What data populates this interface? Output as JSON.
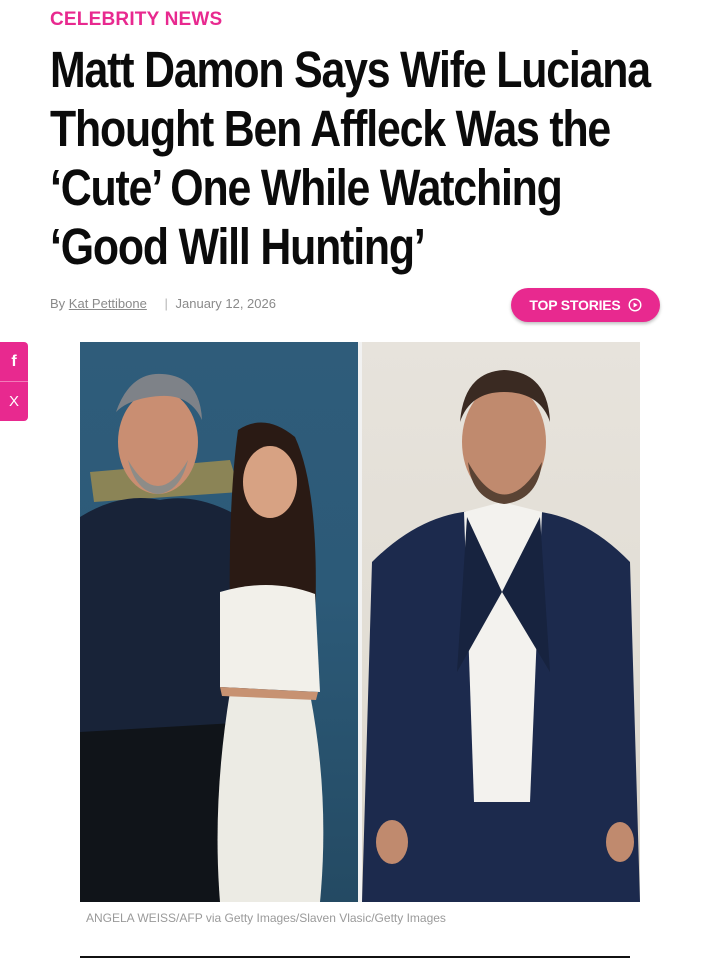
{
  "article": {
    "category": "CELEBRITY NEWS",
    "headline": "Matt Damon Says Wife Luciana Thought Ben Affleck Was the ‘Cute’ One While Watching ‘Good Will Hunting’",
    "byline_prefix": "By",
    "author": "Kat Pettibone",
    "date_separator": "|",
    "date": "January 12, 2026",
    "top_stories_label": "TOP STORIES",
    "photo_credit": "ANGELA WEISS/AFP via Getty Images/Slaven Vlasic/Getty Images"
  },
  "share": {
    "facebook_glyph": "f",
    "x_glyph": "X"
  },
  "icons": {
    "top_stories": "play-circle-icon",
    "facebook": "facebook-icon",
    "x": "x-icon"
  },
  "colors": {
    "accent": "#e8298f",
    "headline": "#0b0b0b",
    "meta": "#8a8a8a"
  }
}
